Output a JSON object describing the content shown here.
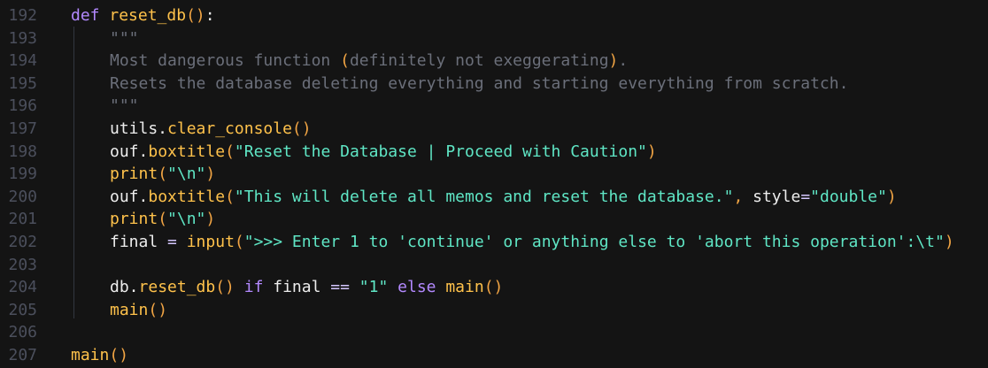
{
  "editor": {
    "lines": [
      {
        "num": "192",
        "parts": [
          {
            "cls": "kw",
            "t": "def "
          },
          {
            "cls": "fn",
            "t": "reset_db"
          },
          {
            "cls": "br",
            "t": "()"
          },
          {
            "cls": "txt",
            "t": ":"
          }
        ]
      },
      {
        "num": "193",
        "indent": 1,
        "parts": [
          {
            "cls": "cmt",
            "t": "\"\"\""
          }
        ]
      },
      {
        "num": "194",
        "indent": 1,
        "parts": [
          {
            "cls": "cmt",
            "t": "Most dangerous function "
          },
          {
            "cls": "br",
            "t": "("
          },
          {
            "cls": "cmt",
            "t": "definitely not exeggerating"
          },
          {
            "cls": "br",
            "t": ")"
          },
          {
            "cls": "cmt",
            "t": "."
          }
        ]
      },
      {
        "num": "195",
        "indent": 1,
        "parts": [
          {
            "cls": "cmt",
            "t": "Resets the database deleting everything and starting everything from scratch."
          }
        ]
      },
      {
        "num": "196",
        "indent": 1,
        "parts": [
          {
            "cls": "cmt",
            "t": "\"\"\""
          }
        ]
      },
      {
        "num": "197",
        "indent": 1,
        "parts": [
          {
            "cls": "txt",
            "t": "utils."
          },
          {
            "cls": "fn",
            "t": "clear_console"
          },
          {
            "cls": "br",
            "t": "()"
          }
        ]
      },
      {
        "num": "198",
        "indent": 1,
        "parts": [
          {
            "cls": "txt",
            "t": "ouf."
          },
          {
            "cls": "fn",
            "t": "boxtitle"
          },
          {
            "cls": "br",
            "t": "("
          },
          {
            "cls": "str",
            "t": "\"Reset the Database | Proceed with Caution\""
          },
          {
            "cls": "br",
            "t": ")"
          }
        ]
      },
      {
        "num": "199",
        "indent": 1,
        "parts": [
          {
            "cls": "fn",
            "t": "print"
          },
          {
            "cls": "br",
            "t": "("
          },
          {
            "cls": "str",
            "t": "\"\\n\""
          },
          {
            "cls": "br",
            "t": ")"
          }
        ]
      },
      {
        "num": "200",
        "indent": 1,
        "parts": [
          {
            "cls": "txt",
            "t": "ouf."
          },
          {
            "cls": "fn",
            "t": "boxtitle"
          },
          {
            "cls": "br",
            "t": "("
          },
          {
            "cls": "str",
            "t": "\"This will delete all memos and reset the database.\""
          },
          {
            "cls": "br",
            "t": ", "
          },
          {
            "cls": "txt",
            "t": "style"
          },
          {
            "cls": "op",
            "t": "="
          },
          {
            "cls": "str",
            "t": "\"double\""
          },
          {
            "cls": "br",
            "t": ")"
          }
        ]
      },
      {
        "num": "201",
        "indent": 1,
        "parts": [
          {
            "cls": "fn",
            "t": "print"
          },
          {
            "cls": "br",
            "t": "("
          },
          {
            "cls": "str",
            "t": "\"\\n\""
          },
          {
            "cls": "br",
            "t": ")"
          }
        ]
      },
      {
        "num": "202",
        "indent": 1,
        "parts": [
          {
            "cls": "txt",
            "t": "final "
          },
          {
            "cls": "op",
            "t": "= "
          },
          {
            "cls": "fn",
            "t": "input"
          },
          {
            "cls": "br",
            "t": "("
          },
          {
            "cls": "str",
            "t": "\">>> Enter 1 to 'continue' or anything else to 'abort this operation':\\t\""
          },
          {
            "cls": "br",
            "t": ")"
          }
        ]
      },
      {
        "num": "203",
        "parts": []
      },
      {
        "num": "204",
        "indent": 1,
        "parts": [
          {
            "cls": "txt",
            "t": "db."
          },
          {
            "cls": "fn",
            "t": "reset_db"
          },
          {
            "cls": "br",
            "t": "() "
          },
          {
            "cls": "kw",
            "t": "if "
          },
          {
            "cls": "txt",
            "t": "final "
          },
          {
            "cls": "op",
            "t": "== "
          },
          {
            "cls": "str",
            "t": "\"1\" "
          },
          {
            "cls": "kw",
            "t": "else "
          },
          {
            "cls": "fn",
            "t": "main"
          },
          {
            "cls": "br",
            "t": "()"
          }
        ]
      },
      {
        "num": "205",
        "indent": 1,
        "parts": [
          {
            "cls": "fn",
            "t": "main"
          },
          {
            "cls": "br",
            "t": "()"
          }
        ]
      },
      {
        "num": "206",
        "parts": []
      },
      {
        "num": "207",
        "parts": [
          {
            "cls": "fn",
            "t": "main"
          },
          {
            "cls": "br",
            "t": "()"
          }
        ]
      }
    ]
  }
}
